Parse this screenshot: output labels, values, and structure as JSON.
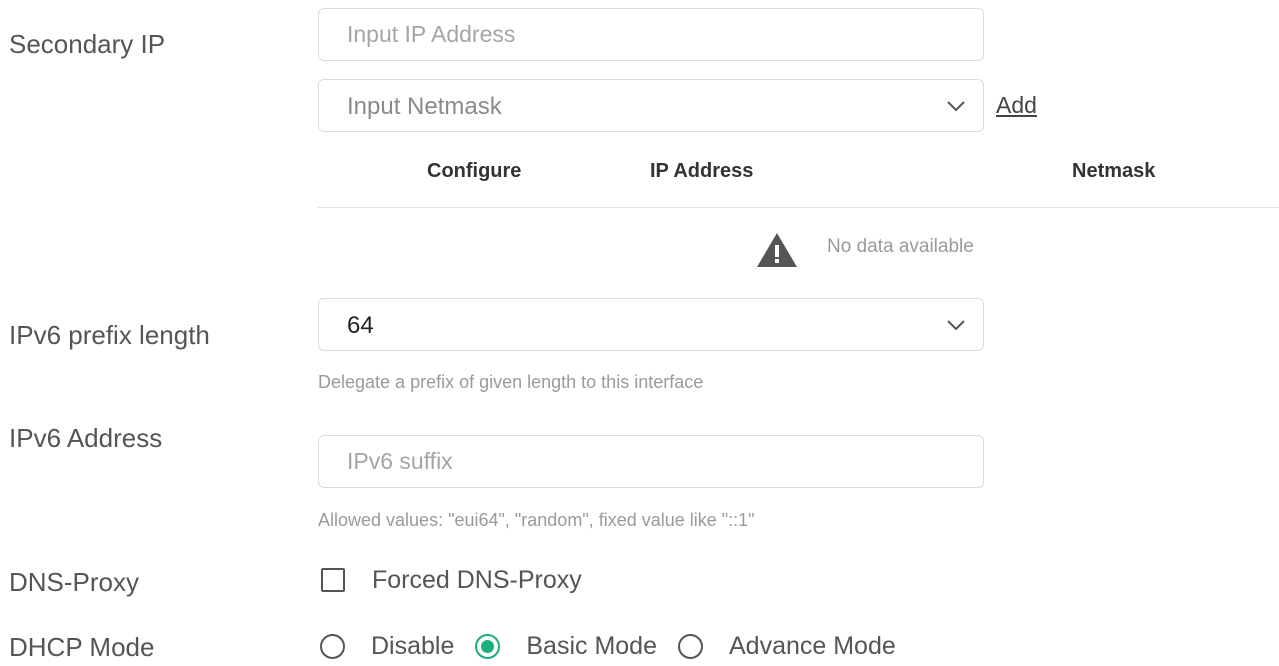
{
  "secondary_ip": {
    "label": "Secondary IP",
    "ip_placeholder": "Input IP Address",
    "netmask_placeholder": "Input Netmask",
    "add_label": "Add",
    "table": {
      "columns": [
        "Configure",
        "IP Address",
        "Netmask"
      ],
      "rows": [],
      "empty_text": "No data available"
    }
  },
  "ipv6_prefix": {
    "label": "IPv6 prefix length",
    "value": "64",
    "hint": "Delegate a prefix of given length to this interface"
  },
  "ipv6_address": {
    "label": "IPv6 Address",
    "placeholder": "IPv6 suffix",
    "hint": "Allowed values: \"eui64\", \"random\", fixed value like \"::1\""
  },
  "dns_proxy": {
    "label": "DNS-Proxy",
    "option_label": "Forced DNS-Proxy",
    "checked": false
  },
  "dhcp_mode": {
    "label": "DHCP Mode",
    "options": [
      {
        "label": "Disable",
        "selected": false
      },
      {
        "label": "Basic Mode",
        "selected": true
      },
      {
        "label": "Advance Mode",
        "selected": false
      }
    ]
  },
  "colors": {
    "accent": "#1bb17a",
    "text": "#555555",
    "hint": "#9a9a9a",
    "border": "#dcdcdc"
  },
  "icons": {
    "chevron": "chevron-down-icon",
    "warning": "warning-icon"
  }
}
